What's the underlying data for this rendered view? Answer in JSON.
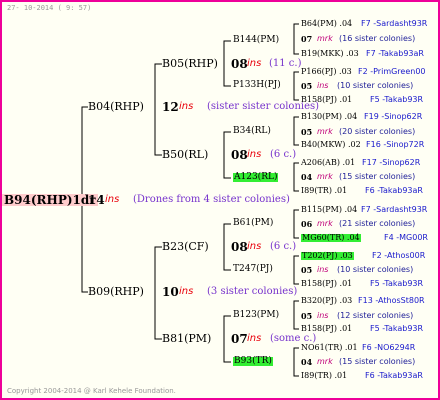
{
  "header": {
    "date": "27- 10-2014 ( 9: 57)"
  },
  "footer": {
    "copyright": "Copyright 2004-2014 @ Karl Kehele Foundation."
  },
  "root": {
    "label": "B94(RHP)1dr",
    "num": "14",
    "ins": "ins",
    "note": "(Drones from 4 sister colonies)"
  },
  "p": {
    "b04": {
      "label": "B04(RHP)",
      "num": "12",
      "ins": "ins",
      "note": "(sister sister colonies)"
    },
    "b09": {
      "label": "B09(RHP)",
      "num": "10",
      "ins": "ins",
      "note": "(3 sister colonies)"
    }
  },
  "g": {
    "b05": {
      "label": "B05(RHP)",
      "num": "08",
      "ins": "ins",
      "note": "(11 c.)"
    },
    "b50": {
      "label": "B50(RL)",
      "num": "08",
      "ins": "ins",
      "note": "(6 c.)"
    },
    "b23": {
      "label": "B23(CF)",
      "num": "08",
      "ins": "ins",
      "note": "(6 c.)"
    },
    "b81": {
      "label": "B81(PM)",
      "num": "07",
      "ins": "ins",
      "note": "(some c.)"
    }
  },
  "gg": {
    "b144": "B144(PM)",
    "p133": "P133H(PJ)",
    "b34": "B34(RL)",
    "a123": "A123(RL)",
    "b61": "B61(PM)",
    "t247": "T247(PJ)",
    "b123": "B123(PM)",
    "b93": "B93(TR)"
  },
  "r": [
    {
      "p1": "B64(PM) .04",
      "s1": "F7 -Sardasht93R",
      "n": "07",
      "m": "mrk",
      "c": "(16 sister colonies)",
      "p2": "B19(MKK) .03",
      "s2": "F7 -Takab93aR"
    },
    {
      "p1": "P166(PJ) .03",
      "s1": "F2 -PrimGreen00",
      "n": "05",
      "m": "ins",
      "c": "(10 sister colonies)",
      "p2": "B158(PJ) .01",
      "s2": "F5 -Takab93R"
    },
    {
      "p1": "B130(PM) .04",
      "s1": "F19 -Sinop62R",
      "n": "05",
      "m": "mrk",
      "c": "(20 sister colonies)",
      "p2": "B40(MKW) .02",
      "s2": "F16 -Sinop72R"
    },
    {
      "p1": "A206(AB) .01",
      "s1": "F17 -Sinop62R",
      "n": "04",
      "m": "mrk",
      "c": "(15 sister colonies)",
      "p2": "I89(TR) .01",
      "s2": "F6 -Takab93aR"
    },
    {
      "p1": "B115(PM) .04",
      "s1": "F7 -Sardasht93R",
      "n": "06",
      "m": "mrk",
      "c": "(21 sister colonies)",
      "p2": "MG60(TR) .04",
      "s2": "F4 -MG00R"
    },
    {
      "p1": "T202(PJ) .03",
      "s1": "F2 -Athos00R",
      "n": "05",
      "m": "ins",
      "c": "(10 sister colonies)",
      "p2": "B158(PJ) .01",
      "s2": "F5 -Takab93R"
    },
    {
      "p1": "B320(PJ) .03",
      "s1": "F13 -AthosSt80R",
      "n": "05",
      "m": "ins",
      "c": "(12 sister colonies)",
      "p2": "B158(PJ) .01",
      "s2": "F5 -Takab93R"
    },
    {
      "p1": "NO61(TR) .01",
      "s1": "F6 -NO6294R",
      "n": "04",
      "m": "mrk",
      "c": "(15 sister colonies)",
      "p2": "I89(TR) .01",
      "s2": "F6 -Takab93aR"
    }
  ]
}
